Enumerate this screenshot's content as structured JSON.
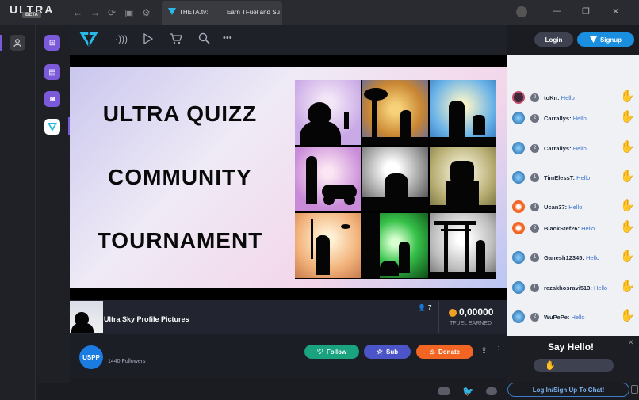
{
  "app": {
    "name": "ULTRA",
    "badge": "BETA"
  },
  "tab": {
    "title": "THETA.tv:",
    "subtitle": "Earn TFuel and Su"
  },
  "header": {
    "login_label": "Login",
    "signup_label": "Signup"
  },
  "banner": {
    "line1": "ULTRA QUIZZ",
    "line2": "COMMUNITY",
    "line3": "TOURNAMENT"
  },
  "stream": {
    "title": "Ultra Sky Profile Pictures",
    "viewers": "7",
    "tfuel_amount": "0,00000",
    "tfuel_label": "TFUEL EARNED"
  },
  "channel": {
    "avatar_text": "USPP",
    "followers": "1440 Followers",
    "follow_label": "Follow",
    "sub_label": "Sub",
    "donate_label": "Donate"
  },
  "chat": {
    "messages": [
      {
        "user": "toKn:",
        "text": "Hello",
        "level": "2"
      },
      {
        "user": "Carrallys:",
        "text": "Hello",
        "level": "2"
      },
      {
        "user": "Carrallys:",
        "text": "Hello",
        "level": "2"
      },
      {
        "user": "TimElessT:",
        "text": "Hello",
        "level": "1"
      },
      {
        "user": "Ucan37:",
        "text": "Hello",
        "level": "3"
      },
      {
        "user": "BlackStef26:",
        "text": "Hello",
        "level": "2"
      },
      {
        "user": "Ganesh12345:",
        "text": "Hello",
        "level": "1"
      },
      {
        "user": "rezakhosravi513:",
        "text": "Hello",
        "level": "1"
      },
      {
        "user": "WuPePe:",
        "text": "Hello",
        "level": "2"
      }
    ],
    "say_hello": "Say Hello!",
    "login_prompt": "Log In/Sign Up To Chat!"
  },
  "colors": {
    "accent": "#1a8fe0",
    "follow": "#1aa37f",
    "sub": "#4c55c8",
    "donate": "#f26522",
    "rail_purple": "#7a5ad8"
  }
}
